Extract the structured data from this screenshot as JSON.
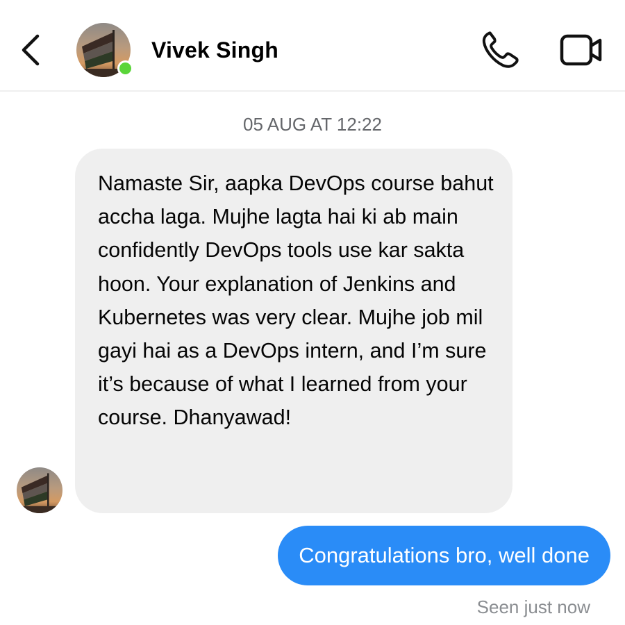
{
  "header": {
    "contact_name": "Vivek Singh",
    "online": true,
    "back_icon": "chevron-left-icon",
    "call_icon": "phone-icon",
    "video_icon": "video-camera-icon"
  },
  "conversation": {
    "timestamp": "05 AUG AT 12:22",
    "messages": [
      {
        "direction": "incoming",
        "text": "Namaste Sir, aapka DevOps course bahut accha laga. Mujhe lagta hai ki ab main confidently DevOps tools use kar sakta hoon. Your explanation of Jenkins and Kubernetes was very clear. Mujhe job mil gayi hai as a DevOps intern, and I’m sure it’s because of what I learned from your course. Dhanyawad!"
      },
      {
        "direction": "outgoing",
        "text": "Congratulations bro, well done"
      }
    ],
    "seen_status": "Seen just now"
  },
  "colors": {
    "outgoing_bubble": "#2a8cf7",
    "incoming_bubble": "#efefef",
    "online_dot": "#5ad539",
    "muted_text": "#65676b"
  }
}
